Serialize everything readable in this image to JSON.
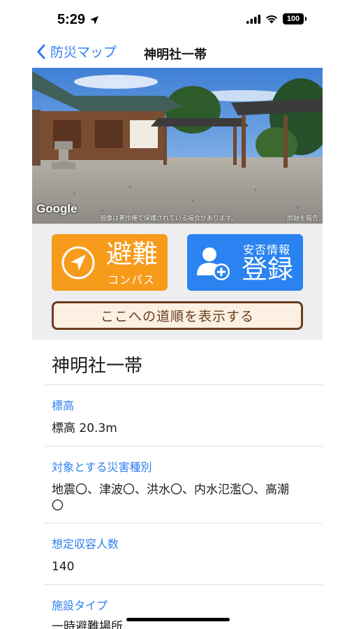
{
  "status_bar": {
    "time": "5:29",
    "battery": "100",
    "location_icon": "location-arrow-icon",
    "signal_icon": "cellular-signal-icon",
    "wifi_icon": "wifi-icon"
  },
  "nav": {
    "back_label": "防災マップ",
    "back_icon": "chevron-left-icon",
    "title": "神明社一帯"
  },
  "street_view": {
    "google_logo": "Google",
    "copyright_notice": "画像は著作権で保護されている場合があります。",
    "report_link": "問題を報告"
  },
  "actions": {
    "compass": {
      "main": "避難",
      "sub": "コンパス",
      "icon": "navigation-arrow-icon",
      "color": "#f79b1b"
    },
    "register": {
      "sub": "安否情報",
      "main": "登録",
      "icon": "add-person-icon",
      "color": "#2a83f0"
    },
    "route_button": "ここへの道順を表示する"
  },
  "detail": {
    "name": "神明社一帯",
    "fields": [
      {
        "label": "標高",
        "value": "標高 20.3m"
      },
      {
        "label": "対象とする災害種別",
        "value_line1": "地震〇、津波〇、洪水〇、内水氾濫〇、高潮",
        "value_line2": "〇"
      },
      {
        "label": "想定収容人数",
        "value": "140"
      },
      {
        "label": "施設タイプ",
        "value": "一時避難場所"
      }
    ]
  },
  "colors": {
    "accent_blue": "#2f7ff2",
    "route_border": "#6b3d1e",
    "route_fill": "#fbf0e2"
  }
}
